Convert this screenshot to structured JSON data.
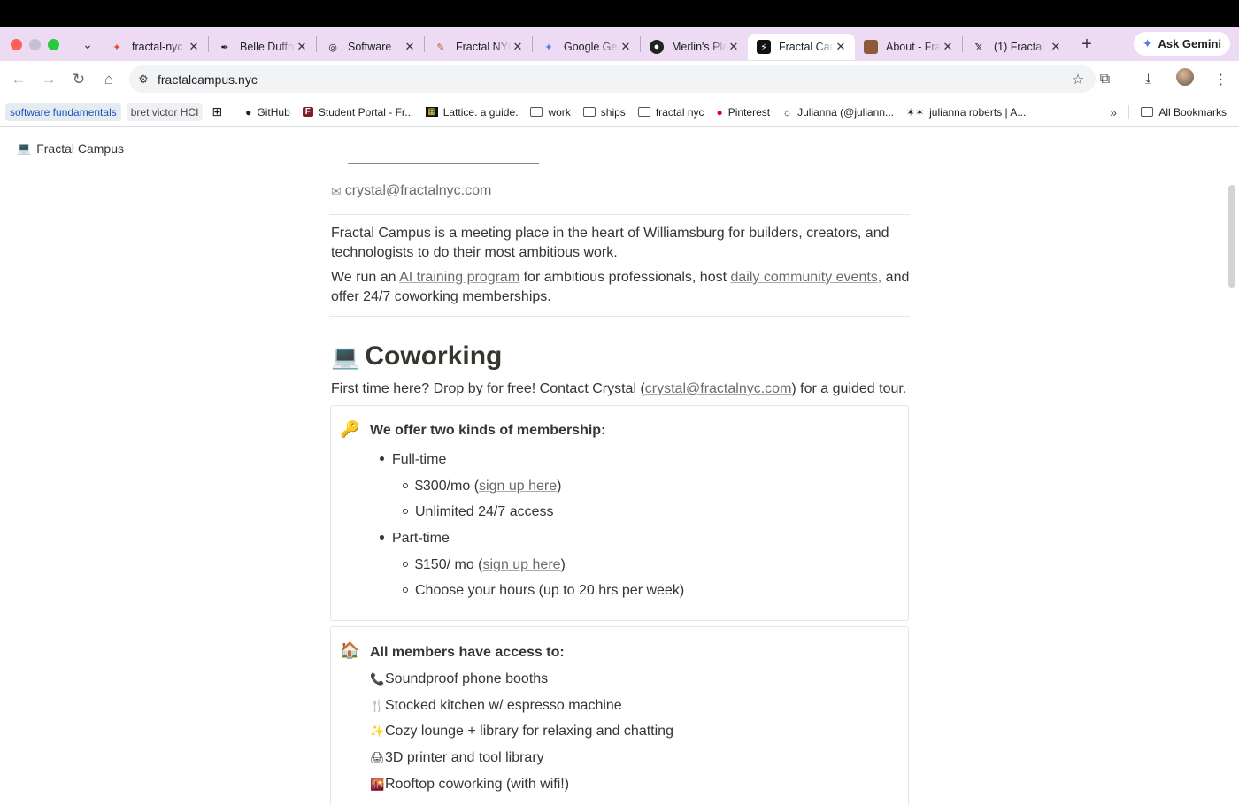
{
  "browser": {
    "tabs": [
      {
        "title": "fractal-nyc",
        "favicon": "figma-icon",
        "active": false
      },
      {
        "title": "Belle Duffner",
        "favicon": "pen-icon",
        "active": false
      },
      {
        "title": "Software",
        "favicon": "globe-icon",
        "active": false
      },
      {
        "title": "Fractal NYC",
        "favicon": "brush-icon",
        "active": false
      },
      {
        "title": "Google Gemini",
        "favicon": "gemini-icon",
        "active": false
      },
      {
        "title": "Merlin's Place",
        "favicon": "cat-icon",
        "active": false
      },
      {
        "title": "Fractal Campus",
        "favicon": "bolt-icon",
        "active": true
      },
      {
        "title": "About - Fractal",
        "favicon": "photo-icon",
        "active": false
      },
      {
        "title": "(1) Fractal",
        "favicon": "x-icon",
        "active": false
      }
    ],
    "gemini_label": "Ask Gemini",
    "url": "fractalcampus.nyc",
    "bookmarks": [
      {
        "label": "software fundamentals",
        "type": "chip-blue"
      },
      {
        "label": "bret victor HCI",
        "type": "chip-grey"
      },
      {
        "label": "",
        "type": "apps"
      },
      {
        "label": "GitHub",
        "icon": "github-icon"
      },
      {
        "label": "Student Portal - Fr...",
        "icon": "f-icon"
      },
      {
        "label": "Lattice. a guide.",
        "icon": "grid-icon"
      },
      {
        "label": "work",
        "icon": "folder-icon"
      },
      {
        "label": "ships",
        "icon": "folder-icon"
      },
      {
        "label": "fractal nyc",
        "icon": "folder-icon"
      },
      {
        "label": "Pinterest",
        "icon": "pinterest-icon"
      },
      {
        "label": "Julianna (@juliann...",
        "icon": "sun-icon"
      },
      {
        "label": "julianna roberts | A...",
        "icon": "sparkle-icon"
      }
    ],
    "all_bookmarks_label": "All Bookmarks"
  },
  "page": {
    "breadcrumb_title": "Fractal Campus",
    "email": "crystal@fractalnyc.com",
    "intro_1": "Fractal Campus is a meeting place in the heart of Williamsburg for builders, creators, and technologists to do their most ambitious work.",
    "intro_2_pre": "We run an ",
    "intro_2_link1": "AI training program",
    "intro_2_mid": " for ambitious professionals, host ",
    "intro_2_link2": "daily community events,",
    "intro_2_post": " and offer 24/7 coworking memberships.",
    "coworking_heading": "Coworking",
    "coworking_sub_pre": "First time here? Drop by for free! Contact Crystal (",
    "coworking_sub_link": "crystal@fractalnyc.com",
    "coworking_sub_post": ") for a guided tour.",
    "membership": {
      "title": "We offer two kinds of membership:",
      "full_time": "Full-time",
      "full_price_pre": "$300/mo (",
      "full_signup": "sign up here",
      "full_price_post": ")",
      "full_access": "Unlimited 24/7 access",
      "part_time": "Part-time",
      "part_price_pre": "$150/ mo (",
      "part_signup": "sign up here",
      "part_price_post": ")",
      "part_hours": "Choose your hours (up to 20 hrs per week)"
    },
    "amenities": {
      "title": "All members have access to:",
      "items": [
        {
          "icon": "phone-icon",
          "label": "Soundproof phone booths"
        },
        {
          "icon": "utensils-icon",
          "label": "Stocked kitchen w/ espresso machine"
        },
        {
          "icon": "sparkles-icon",
          "label": "Cozy lounge + library for relaxing and chatting"
        },
        {
          "icon": "printer-icon",
          "label": "3D printer and tool library"
        },
        {
          "icon": "sunset-icon",
          "label": "Rooftop coworking (with wifi!)"
        }
      ]
    }
  }
}
